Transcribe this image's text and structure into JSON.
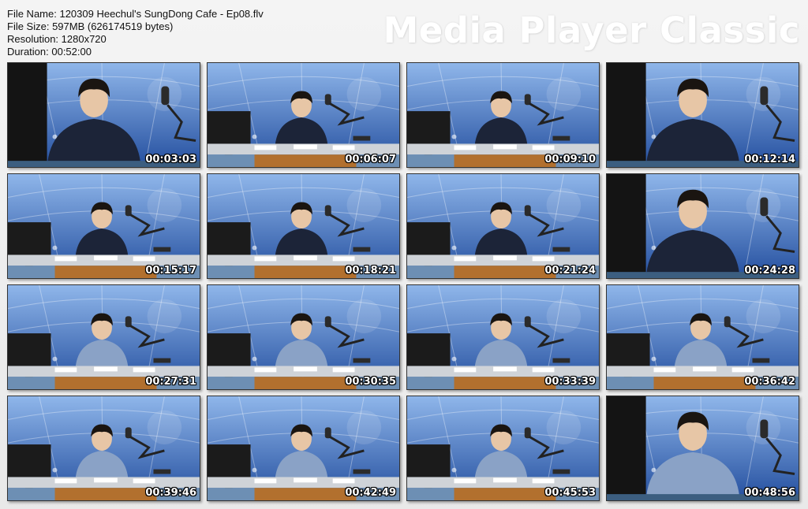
{
  "info": {
    "file_name": "File Name: 120309 Heechul's SungDong Cafe - Ep08.flv",
    "file_size": "File Size: 597MB (626174519 bytes)",
    "resolution": "Resolution: 1280x720",
    "duration": "Duration: 00:52:00"
  },
  "watermark": "Media Player Classic",
  "thumbnails": [
    {
      "timestamp": "00:03:03",
      "shot": "closeup",
      "outfit": "jacket"
    },
    {
      "timestamp": "00:06:07",
      "shot": "wide",
      "outfit": "jacket"
    },
    {
      "timestamp": "00:09:10",
      "shot": "wide",
      "outfit": "jacket"
    },
    {
      "timestamp": "00:12:14",
      "shot": "closeup",
      "outfit": "jacket"
    },
    {
      "timestamp": "00:15:17",
      "shot": "wide",
      "outfit": "jacket"
    },
    {
      "timestamp": "00:18:21",
      "shot": "wide",
      "outfit": "jacket"
    },
    {
      "timestamp": "00:21:24",
      "shot": "wide",
      "outfit": "jacket"
    },
    {
      "timestamp": "00:24:28",
      "shot": "closeup",
      "outfit": "jacket"
    },
    {
      "timestamp": "00:27:31",
      "shot": "wide",
      "outfit": "shirt"
    },
    {
      "timestamp": "00:30:35",
      "shot": "wide",
      "outfit": "shirt"
    },
    {
      "timestamp": "00:33:39",
      "shot": "wide",
      "outfit": "shirt"
    },
    {
      "timestamp": "00:36:42",
      "shot": "wide",
      "outfit": "shirt"
    },
    {
      "timestamp": "00:39:46",
      "shot": "wide",
      "outfit": "shirt"
    },
    {
      "timestamp": "00:42:49",
      "shot": "wide",
      "outfit": "shirt"
    },
    {
      "timestamp": "00:45:53",
      "shot": "wide",
      "outfit": "shirt"
    },
    {
      "timestamp": "00:48:56",
      "shot": "closeup",
      "outfit": "shirt"
    }
  ],
  "colors": {
    "backdrop_light": "#8fb6ea",
    "backdrop_dark": "#244f9f",
    "jacket": "#1c2438",
    "shirt": "#8aa2c6",
    "desk": "#cfd3d8",
    "desk_front": "#b2702e",
    "skin": "#e7c6a6",
    "hair": "#1a1511"
  }
}
